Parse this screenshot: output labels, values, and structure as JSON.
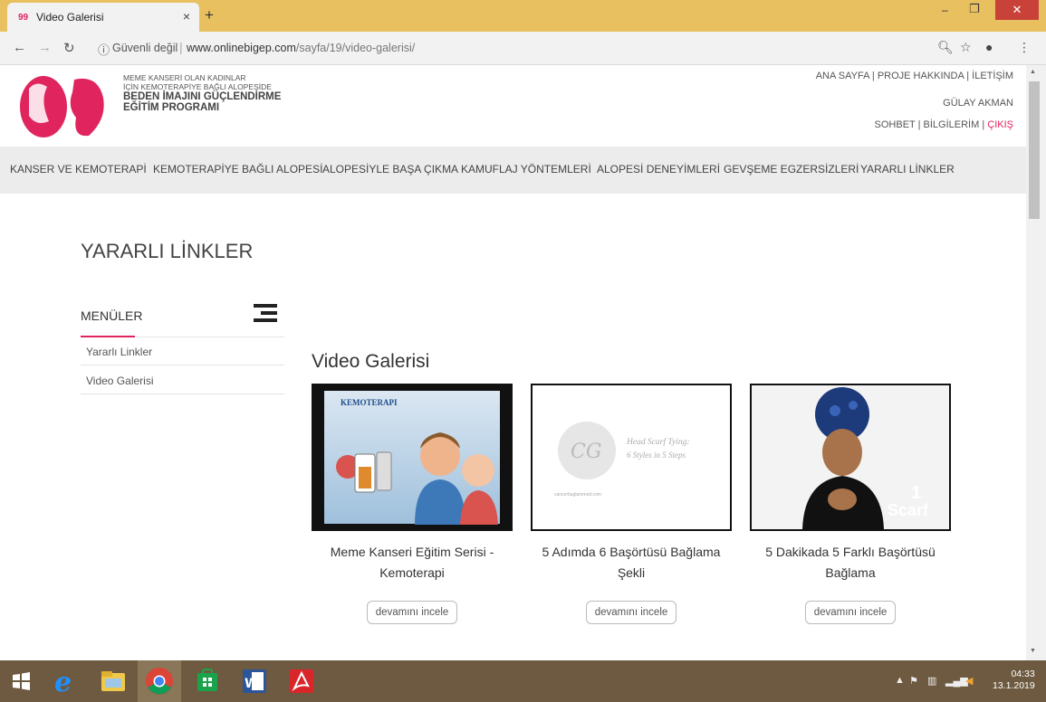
{
  "browser": {
    "tab_title": "Video Galerisi",
    "tab_favicon": "99",
    "tab_close": "×",
    "new_tab": "+",
    "window_controls": {
      "minimize": "–",
      "maximize": "❐",
      "close": "✕"
    },
    "security_label": "Güvenli değil",
    "url_host": "www.onlinebigep.com",
    "url_path": "/sayfa/19/video-galerisi/",
    "icons": [
      "back-arrow-icon",
      "forward-arrow-icon",
      "reload-icon",
      "info-icon",
      "zoom-icon",
      "star-icon",
      "account-icon",
      "menu-dots-icon"
    ]
  },
  "site": {
    "logo_lines_small": [
      "MEME KANSERİ OLAN KADINLAR",
      "İÇİN KEMOTERAPİYE BAĞLI ALOPESİDE"
    ],
    "logo_lines_big": [
      "BEDEN İMAJINI GÜÇLENDİRME",
      "EĞİTİM PROGRAMI"
    ],
    "top_links": [
      "ANA SAYFA",
      "PROJE HAKKINDA",
      "İLETİŞİM"
    ],
    "username": "GÜLAY AKMAN",
    "user_links": [
      "SOHBET",
      "BİLGİLERİM",
      "ÇIKIŞ"
    ],
    "separator": "|",
    "accent_color": "#e0245e"
  },
  "main_nav": [
    "KANSER VE KEMOTERAPİ",
    "KEMOTERAPİYE BAĞLI ALOPESİ",
    "ALOPESİYLE BAŞA ÇIKMA",
    "KAMUFLAJ YÖNTEMLERİ",
    "ALOPESİ DENEYİMLERİ",
    "GEVŞEME EGZERSİZLERİ",
    "YARARLI LİNKLER"
  ],
  "page_title": "YARARLI LİNKLER",
  "sidebar": {
    "heading": "MENÜLER",
    "items": [
      "Yararlı Linkler",
      "Video Galerisi"
    ]
  },
  "gallery": {
    "title": "Video Galerisi",
    "button_label": "devamını incele",
    "videos": [
      {
        "title": "Meme Kanseri Eğitim Serisi - Kemoterapi",
        "thumb_caption": "KEMOTERAPI"
      },
      {
        "title": "5 Adımda 6 Başörtüsü Bağlama Şekli",
        "thumb_caption_1": "Head Scarf Tying:",
        "thumb_caption_2": "6 Styles in 5 Steps",
        "thumb_footer": "cancerbaglammed.com"
      },
      {
        "title": "5 Dakikada 5 Farklı Başörtüsü Bağlama",
        "thumb_caption_1": "1",
        "thumb_caption_2": "Scarf"
      }
    ]
  },
  "taskbar": {
    "time": "04:33",
    "date": "13.1.2019"
  }
}
